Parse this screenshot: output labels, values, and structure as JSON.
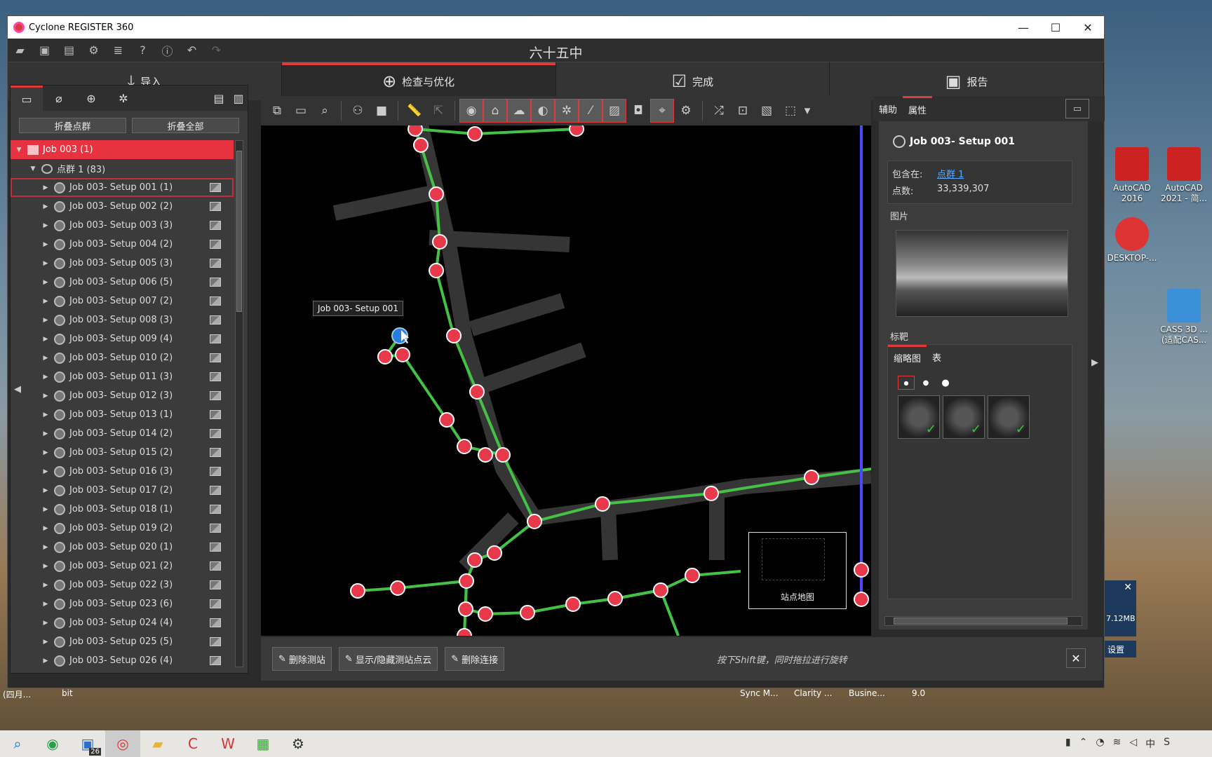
{
  "window": {
    "title": "Cyclone REGISTER 360",
    "project_name": "六十五中",
    "minimize": "—",
    "maximize": "☐",
    "close": "✕"
  },
  "workflow_steps": [
    {
      "label": "导入",
      "icon": "import-icon"
    },
    {
      "label": "检查与优化",
      "icon": "inspect-icon",
      "active": true
    },
    {
      "label": "完成",
      "icon": "finalize-icon"
    },
    {
      "label": "报告",
      "icon": "report-icon"
    }
  ],
  "left_panel": {
    "collapse_clusters": "折叠点群",
    "collapse_all": "折叠全部",
    "job": "Job 003 (1)",
    "cluster": "点群 1 (83)",
    "setups": [
      "Job 003- Setup 001 (1)",
      "Job 003- Setup 002 (2)",
      "Job 003- Setup 003 (3)",
      "Job 003- Setup 004 (2)",
      "Job 003- Setup 005 (3)",
      "Job 003- Setup 006 (5)",
      "Job 003- Setup 007 (2)",
      "Job 003- Setup 008 (3)",
      "Job 003- Setup 009 (4)",
      "Job 003- Setup 010 (2)",
      "Job 003- Setup 011 (3)",
      "Job 003- Setup 012 (3)",
      "Job 003- Setup 013 (1)",
      "Job 003- Setup 014 (2)",
      "Job 003- Setup 015 (2)",
      "Job 003- Setup 016 (3)",
      "Job 003- Setup 017 (2)",
      "Job 003- Setup 018 (1)",
      "Job 003- Setup 019 (2)",
      "Job 003- Setup 020 (1)",
      "Job 003- Setup 021 (2)",
      "Job 003- Setup 022 (3)",
      "Job 003- Setup 023 (6)",
      "Job 003- Setup 024 (4)",
      "Job 003- Setup 025 (5)",
      "Job 003- Setup 026 (4)"
    ]
  },
  "viewport": {
    "tooltip": "Job 003- Setup 001",
    "minimap_label": "站点地图"
  },
  "bottom_bar": {
    "delete_setup": "删除测站",
    "toggle_cloud": "显示/隐藏测站点云",
    "delete_link": "删除连接",
    "hint": "按下Shift键，同时拖拉进行旋转"
  },
  "right_panel": {
    "tabs": [
      "辅助",
      "属性"
    ],
    "setup_title": "Job 003- Setup 001",
    "contained_in_label": "包含在:",
    "contained_in_value": "点群 1",
    "points_label": "点数:",
    "points_value": "33,339,307",
    "images_label": "图片",
    "targets_label": "标靶",
    "target_tabs": [
      "缩略图",
      "表"
    ]
  },
  "desktop": {
    "icons": [
      "AutoCAD 2016",
      "AutoCAD 2021 - 简...",
      "DESKTOP-...",
      "CASS 3D ...(适配CAS..."
    ]
  },
  "taskbar_strip": {
    "items": [
      "(四月...",
      "bit",
      "Sync M...",
      "Clarity ...",
      "Busine...",
      "9.0"
    ],
    "notify_size": "7.12MB",
    "notify_settings": "设置",
    "desk_badge": "26"
  },
  "colors": {
    "accent": "#e03a3a",
    "link_green": "#45c145",
    "node_red": "#e8394a"
  }
}
